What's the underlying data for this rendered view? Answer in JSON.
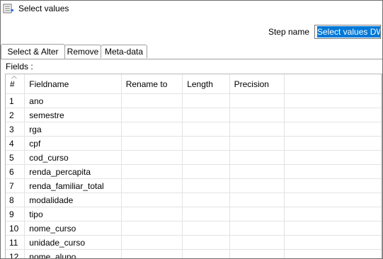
{
  "window": {
    "title": "Select values"
  },
  "step": {
    "label": "Step name",
    "value": "Select values DW"
  },
  "tabs": [
    {
      "label": "Select & Alter",
      "active": true
    },
    {
      "label": "Remove",
      "active": false
    },
    {
      "label": "Meta-data",
      "active": false
    }
  ],
  "fields": {
    "label": "Fields :",
    "columns": [
      "#",
      "Fieldname",
      "Rename to",
      "Length",
      "Precision"
    ],
    "rows": [
      {
        "num": "1",
        "fieldname": "ano"
      },
      {
        "num": "2",
        "fieldname": "semestre"
      },
      {
        "num": "3",
        "fieldname": "rga"
      },
      {
        "num": "4",
        "fieldname": "cpf"
      },
      {
        "num": "5",
        "fieldname": "cod_curso"
      },
      {
        "num": "6",
        "fieldname": "renda_percapita"
      },
      {
        "num": "7",
        "fieldname": "renda_familiar_total"
      },
      {
        "num": "8",
        "fieldname": "modalidade"
      },
      {
        "num": "9",
        "fieldname": "tipo"
      },
      {
        "num": "10",
        "fieldname": "nome_curso"
      },
      {
        "num": "11",
        "fieldname": "unidade_curso"
      },
      {
        "num": "12",
        "fieldname": "nome_aluno"
      }
    ]
  },
  "colors": {
    "selection": "#0078d7",
    "border": "#a0a0a0",
    "grid_line": "#e3e3e3"
  }
}
